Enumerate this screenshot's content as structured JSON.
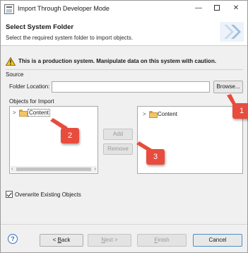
{
  "window": {
    "title": "Import Through Developer Mode",
    "minimize_glyph": "—",
    "close_glyph": "✕"
  },
  "banner": {
    "title": "Select System Folder",
    "subtitle": "Select the required system folder to import objects."
  },
  "warning": {
    "text": "This is a production system. Manipulate data on this system with caution."
  },
  "source": {
    "section_label": "Source",
    "folder_label": "Folder Location:",
    "folder_value": "",
    "browse_label": "Browse..."
  },
  "objects": {
    "section_label": "Objects for Import",
    "left_tree": [
      {
        "label": "Content",
        "expanded": false,
        "selected": true
      }
    ],
    "right_tree": [
      {
        "label": "Content",
        "expanded": false,
        "selected": false
      }
    ],
    "add_label": "Add",
    "remove_label": "Remove"
  },
  "options": {
    "overwrite_label": "Overwrite Existing Objects",
    "overwrite_checked": true
  },
  "footer": {
    "help_glyph": "?",
    "back_mnemonic": "B",
    "back_rest": "ack",
    "back_prefix": "< ",
    "next_mnemonic": "N",
    "next_rest": "ext >",
    "finish_mnemonic": "F",
    "finish_rest": "inish",
    "cancel_label": "Cancel"
  },
  "callouts": [
    "1",
    "2",
    "3"
  ],
  "colors": {
    "callout": "#e84c3d",
    "warning_fill": "#f5c518",
    "folder": "#f1c765",
    "accent": "#4f8cc9"
  },
  "icons": {
    "app": "window-app-icon",
    "warning": "warning-triangle-icon",
    "folder": "folder-icon",
    "help": "help-icon",
    "banner": "wizard-chevron-graphic"
  }
}
